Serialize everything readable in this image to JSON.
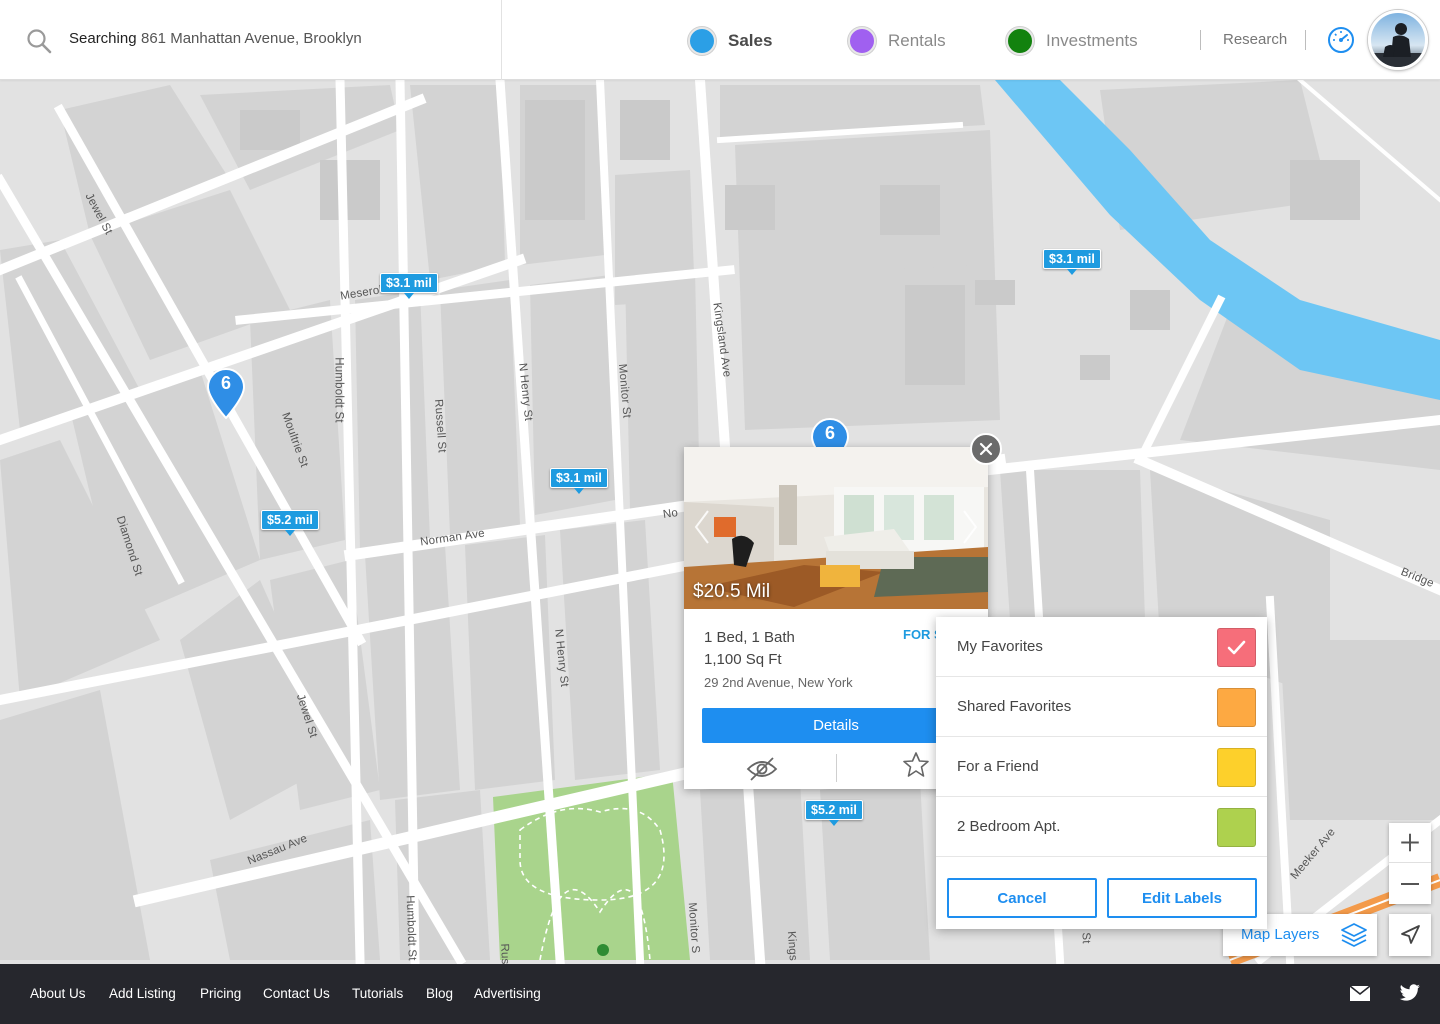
{
  "header": {
    "search_label": "Searching",
    "search_value": "861 Manhattan Avenue, Brooklyn",
    "modes": [
      {
        "label": "Sales",
        "color": "#2b9fe6",
        "active": true
      },
      {
        "label": "Rentals",
        "color": "#a060f0",
        "active": false
      },
      {
        "label": "Investments",
        "color": "#12820e",
        "active": false
      }
    ],
    "research_label": "Research",
    "icons": {
      "search": "search-icon",
      "dashboard": "dashboard-icon",
      "avatar": "user-avatar"
    }
  },
  "map": {
    "streets": [
      "Jewel St",
      "Meserole A",
      "Humboldt St",
      "Moultrie St",
      "Russell St",
      "N Henry St",
      "Monitor St",
      "Kingsland Ave",
      "Diamond St",
      "Norman Ave",
      "No",
      "Jewel St",
      "N Henry St",
      "Nassau Ave",
      "Humboldt St",
      "Rus",
      "Monitor S",
      "Kings",
      "Bridge",
      "Meeker Ave",
      "St"
    ],
    "price_pins": [
      "$3.1 mil",
      "$3.1 mil",
      "$3.1 mil",
      "$5.2 mil",
      "$5.2 mil"
    ],
    "clusters": [
      "6",
      "6"
    ],
    "colors": {
      "water": "#6dc6f4",
      "park": "#a8d58a",
      "road": "#ffffff",
      "highway": "#f39a4a",
      "pin": "#1e9be0"
    }
  },
  "listing": {
    "price": "$20.5 Mil",
    "beds_baths": "1 Bed, 1 Bath",
    "sqft": "1,100 Sq Ft",
    "address": "29 2nd Avenue, New York",
    "status": "FOR S",
    "details_label": "Details",
    "icons": [
      "hide-icon",
      "star-icon",
      "close-icon",
      "chevron-left-icon",
      "chevron-right-icon"
    ]
  },
  "favorites": {
    "items": [
      {
        "label": "My Favorites",
        "color": "#f66e7a",
        "checked": true
      },
      {
        "label": "Shared Favorites",
        "color": "#fda942",
        "checked": false
      },
      {
        "label": "For a Friend",
        "color": "#fdd02b",
        "checked": false
      },
      {
        "label": "2 Bedroom Apt.",
        "color": "#aed14e",
        "checked": false
      }
    ],
    "cancel_label": "Cancel",
    "edit_label": "Edit Labels"
  },
  "controls": {
    "map_layers_label": "Map Layers",
    "icons": [
      "zoom-in-icon",
      "zoom-out-icon",
      "layers-icon",
      "locate-icon"
    ]
  },
  "footer": {
    "links": [
      "About Us",
      "Add Listing",
      "Pricing",
      "Contact Us",
      "Tutorials",
      "Blog",
      "Advertising"
    ],
    "icons": [
      "mail-icon",
      "twitter-icon"
    ]
  }
}
